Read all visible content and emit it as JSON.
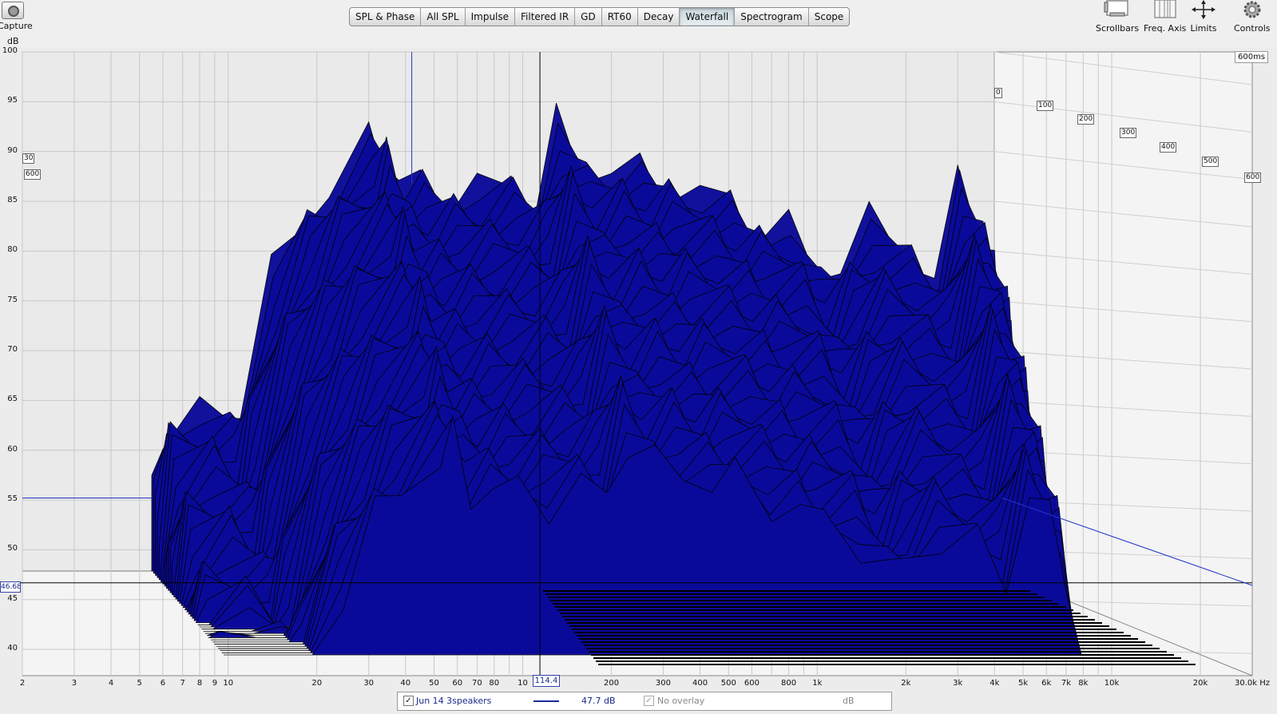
{
  "toolbar": {
    "capture_label": "Capture",
    "tabs": [
      {
        "label": "SPL & Phase"
      },
      {
        "label": "All SPL"
      },
      {
        "label": "Impulse"
      },
      {
        "label": "Filtered IR"
      },
      {
        "label": "GD"
      },
      {
        "label": "RT60"
      },
      {
        "label": "Decay"
      },
      {
        "label": "Waterfall",
        "active": true
      },
      {
        "label": "Spectrogram"
      },
      {
        "label": "Scope"
      }
    ],
    "tools": [
      {
        "label": "Scrollbars",
        "icon": "scrollbars-icon"
      },
      {
        "label": "Freq. Axis",
        "icon": "freq-axis-icon"
      },
      {
        "label": "Limits",
        "icon": "limits-icon"
      },
      {
        "label": "Controls",
        "icon": "gear-icon"
      }
    ]
  },
  "plot": {
    "y_unit": "dB",
    "y_ticks": [
      "100",
      "95",
      "90",
      "85",
      "80",
      "75",
      "70",
      "65",
      "60",
      "55",
      "50",
      "45",
      "40"
    ],
    "x_ticks": [
      "2",
      "3",
      "4",
      "5",
      "6",
      "7",
      "8",
      "9",
      "10",
      "20",
      "30",
      "40",
      "50",
      "60",
      "70",
      "80",
      "10",
      "200",
      "300",
      "400",
      "500",
      "600",
      "800",
      "1k",
      "2k",
      "3k",
      "4k",
      "5k",
      "6k",
      "7k",
      "8k",
      "10k",
      "20k",
      "30.0k Hz"
    ],
    "cursor_y_value": "46.68",
    "cursor_x_value": "114.4",
    "time_corner_label": "600ms",
    "time_labels": [
      "0",
      "100",
      "200",
      "300",
      "400",
      "500",
      "600"
    ],
    "left_side_labels": [
      "30",
      "600"
    ]
  },
  "chart_data": {
    "type": "area",
    "title": "",
    "xlabel": "Hz",
    "ylabel": "dB",
    "xscale": "log",
    "xlim": [
      2,
      30000
    ],
    "ylim": [
      38,
      100
    ],
    "zlabel": "ms",
    "zlim": [
      0,
      600
    ],
    "grid": true,
    "series": [
      {
        "name": "Jun 14 3speakers",
        "color": "#0a0a9a",
        "x": [
          5.5,
          6,
          8,
          10,
          11,
          14,
          18,
          22,
          30,
          33,
          38,
          45,
          55,
          70,
          90,
          110,
          130,
          160,
          200,
          250,
          300,
          400,
          500,
          600,
          800,
          1000,
          1200,
          1500,
          2000,
          2500,
          3000,
          3500,
          4000,
          4500
        ],
        "values": [
          55,
          63,
          64,
          62,
          66,
          77,
          83,
          87,
          90,
          91,
          87,
          86,
          86,
          86,
          86,
          86,
          92,
          88,
          89,
          87,
          87,
          86,
          84,
          83,
          82,
          77,
          80,
          82,
          80,
          78,
          86,
          83,
          79,
          47
        ]
      }
    ],
    "cursor": {
      "x": 114.4,
      "y": 46.68
    },
    "legend": {
      "trace_level": "47.7 dB",
      "overlay": "No overlay",
      "overlay_unit": "dB",
      "position": "bottom"
    }
  }
}
